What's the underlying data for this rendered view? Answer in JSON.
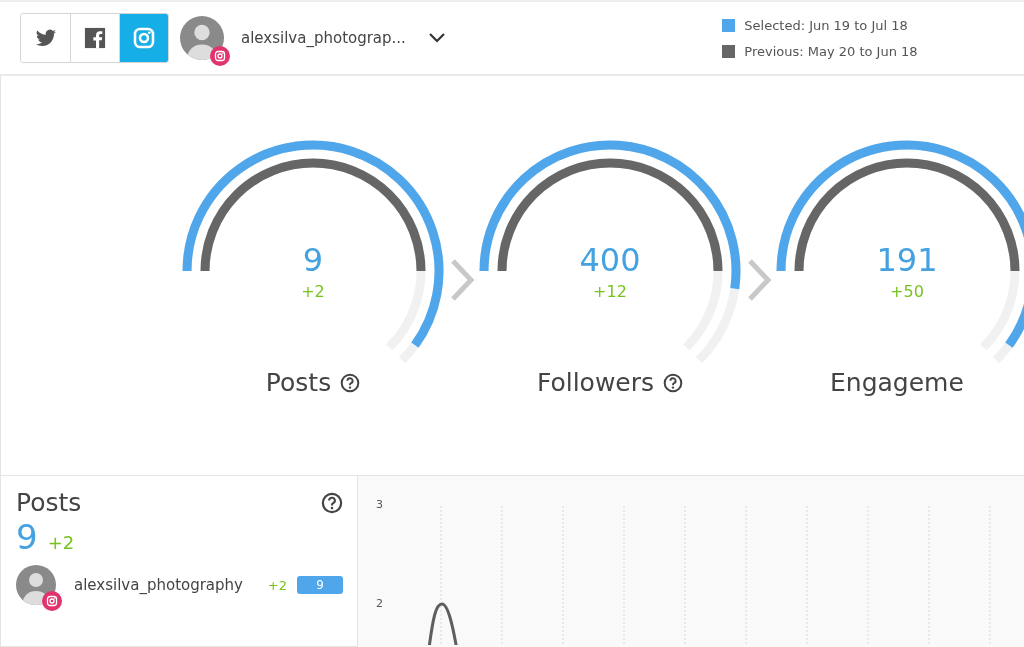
{
  "header": {
    "networks": [
      {
        "kind": "twitter",
        "selected": false
      },
      {
        "kind": "facebook",
        "selected": false
      },
      {
        "kind": "instagram",
        "selected": true
      }
    ],
    "account": {
      "name": "alexsilva_photograp..."
    },
    "legend": [
      {
        "label": "Selected: Jun 19 to Jul 18",
        "color": "#4fa6ea"
      },
      {
        "label": "Previous: May 20 to Jun 18",
        "color": "#666666"
      }
    ]
  },
  "gauges": [
    {
      "value": "9",
      "delta": "+2",
      "label": "Posts",
      "help_icon": true
    },
    {
      "value": "400",
      "delta": "+12",
      "label": "Followers",
      "help_icon": true
    },
    {
      "value": "191",
      "delta": "+50",
      "label": "Engageme",
      "help_icon": false
    }
  ],
  "detail": {
    "title": "Posts",
    "value": "9",
    "delta": "+2",
    "accounts": [
      {
        "name": "alexsilva_photography",
        "delta": "+2",
        "count": "9"
      }
    ],
    "chart": {
      "y_labels": [
        "3",
        "2"
      ]
    }
  }
}
